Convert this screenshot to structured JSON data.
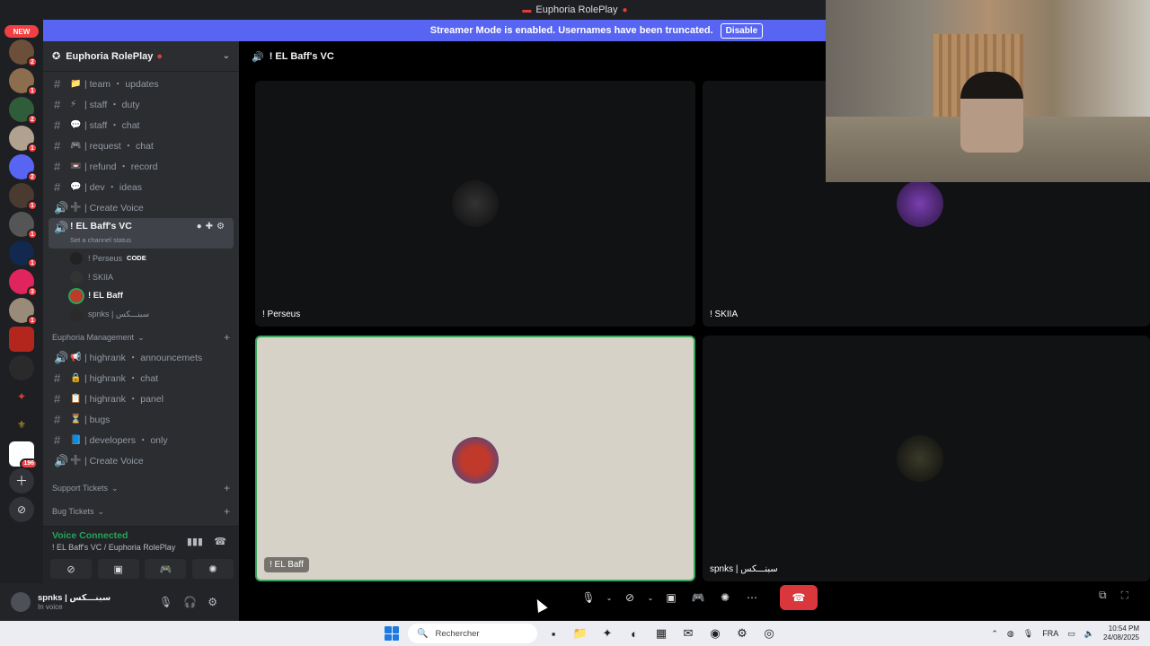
{
  "window": {
    "title": "Euphoria RolePlay"
  },
  "banner": {
    "text": "Streamer Mode is enabled. Usernames have been truncated.",
    "disable_label": "Disable"
  },
  "rail": {
    "new_label": "NEW",
    "badges": [
      "2",
      "1",
      "2",
      "1",
      "2",
      "1",
      "1",
      "1",
      "1",
      "3",
      "1",
      "196"
    ]
  },
  "server": {
    "name": "Euphoria RolePlay"
  },
  "channels": [
    {
      "label": "| team ・ updates",
      "emoji": "📁"
    },
    {
      "label": "| staff ・ duty",
      "emoji": "⚡"
    },
    {
      "label": "| staff ・ chat",
      "emoji": "💬"
    },
    {
      "label": "| request ・ chat",
      "emoji": "🎮"
    },
    {
      "label": "| refund ・ record",
      "emoji": "📼"
    },
    {
      "label": "| dev ・ ideas",
      "emoji": "💬"
    },
    {
      "label": "| Create Voice",
      "emoji": "➕"
    }
  ],
  "active_channel": {
    "label": "! EL Baff's VC",
    "status": "Set a channel status"
  },
  "voice_users": [
    {
      "name": "! Perseus",
      "tag": "CODE"
    },
    {
      "name": "! SKIIA",
      "tag": ""
    },
    {
      "name": "! EL Baff",
      "tag": ""
    },
    {
      "name": "spnks | سبنـــكس",
      "tag": ""
    }
  ],
  "categories": {
    "management": "Euphoria Management",
    "support": "Support Tickets",
    "bug": "Bug Tickets"
  },
  "mgmt_channels": [
    {
      "label": "| highrank ・ announcemets",
      "emoji": "📢"
    },
    {
      "label": "| highrank ・ chat",
      "emoji": "🔒"
    },
    {
      "label": "| highrank ・ panel",
      "emoji": "📋"
    },
    {
      "label": "| bugs",
      "emoji": "⏳"
    },
    {
      "label": "| developers ・ only",
      "emoji": "📘"
    },
    {
      "label": "| Create Voice",
      "emoji": "➕"
    }
  ],
  "voice_panel": {
    "status": "Voice Connected",
    "location": "! EL Baff's VC / Euphoria RolePlay"
  },
  "user": {
    "name": "spnks | سبنـــكس",
    "status": "In voice"
  },
  "stage": {
    "title": "! EL Baff's VC",
    "tiles": [
      {
        "name": "! Perseus"
      },
      {
        "name": "! SKIIA"
      },
      {
        "name": "! EL Baff"
      },
      {
        "name": "spnks | سبنـــكس"
      }
    ]
  },
  "taskbar": {
    "search_placeholder": "Rechercher",
    "lang": "FRA",
    "time": "10:54 PM",
    "date": "24/08/2025"
  },
  "colors": {
    "blurple": "#5865f2",
    "green": "#23a55a",
    "red": "#da373c",
    "speaking": "#3ba55d"
  }
}
